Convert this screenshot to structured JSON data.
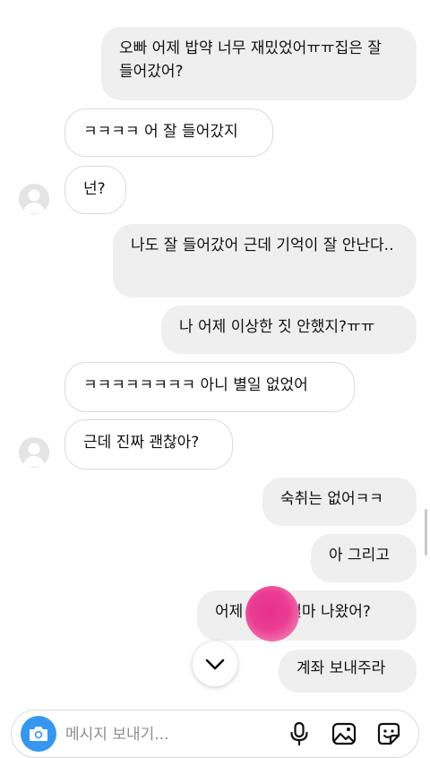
{
  "chat": {
    "messages": [
      {
        "from": "me",
        "text": "오빠 어제 밥약 너무 재밌었어ㅠㅠ집은 잘 들어갔어?"
      },
      {
        "from": "other",
        "text": "ㅋㅋㅋㅋ 어 잘 들어갔지"
      },
      {
        "from": "other",
        "text": "넌?"
      },
      {
        "from": "me",
        "text": "나도 잘 들어갔어 근데 기억이 잘 안난다.."
      },
      {
        "from": "me",
        "text": "나 어제 이상한 짓 안했지?ㅠㅠ"
      },
      {
        "from": "other",
        "text": "ㅋㅋㅋㅋㅋㅋㅋㅋ 아니 별일 없었어"
      },
      {
        "from": "other",
        "text": "근데 진짜 괜찮아?"
      },
      {
        "from": "me",
        "text": "숙취는 없어ㅋㅋ"
      },
      {
        "from": "me",
        "text": "아 그리고"
      },
      {
        "from": "me",
        "text_start": "어제",
        "text_end": "얼마 나왔어?"
      },
      {
        "from": "me",
        "text": "계좌 보내주라"
      }
    ]
  },
  "composer": {
    "placeholder": "메시지 보내기..."
  },
  "icons": {
    "camera": "camera-icon",
    "microphone": "microphone-icon",
    "gallery": "gallery-icon",
    "sticker": "sticker-icon",
    "scroll_down": "chevron-down-icon",
    "avatar": "avatar-placeholder-icon"
  },
  "colors": {
    "accent": "#3797f0",
    "outgoing_bubble": "#efefef",
    "incoming_border": "#dbdbdb",
    "redaction": "#e8308a"
  }
}
